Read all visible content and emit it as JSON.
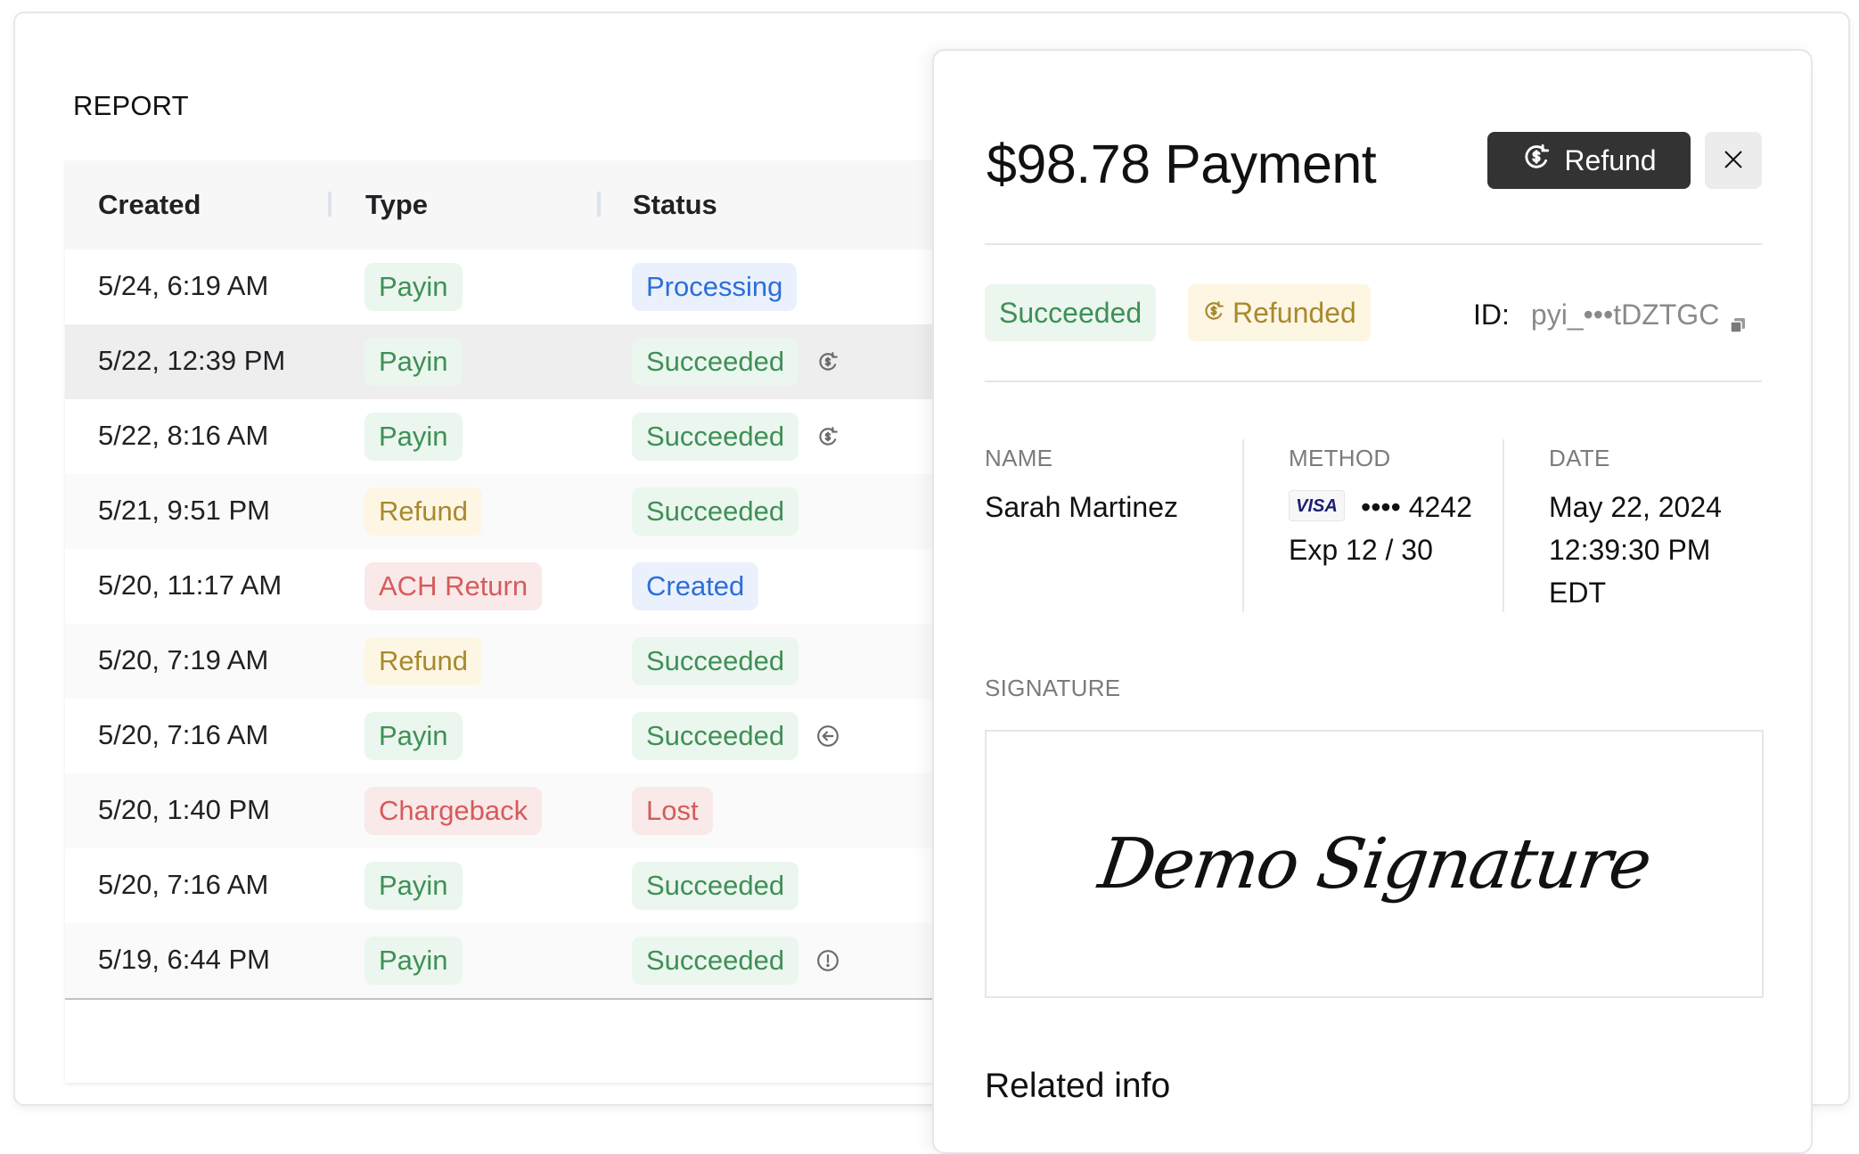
{
  "report": {
    "title": "REPORT",
    "columns": [
      "Created",
      "Type",
      "Status"
    ],
    "rows": [
      {
        "created": "5/24, 6:19 AM",
        "type": "Payin",
        "type_color": "green",
        "status": "Processing",
        "status_color": "blue",
        "icon": null,
        "selected": false
      },
      {
        "created": "5/22, 12:39 PM",
        "type": "Payin",
        "type_color": "green",
        "status": "Succeeded",
        "status_color": "green",
        "icon": "refund-icon",
        "selected": true
      },
      {
        "created": "5/22, 8:16 AM",
        "type": "Payin",
        "type_color": "green",
        "status": "Succeeded",
        "status_color": "green",
        "icon": "refund-icon",
        "selected": false
      },
      {
        "created": "5/21, 9:51 PM",
        "type": "Refund",
        "type_color": "yellow",
        "status": "Succeeded",
        "status_color": "green",
        "icon": null,
        "selected": false
      },
      {
        "created": "5/20, 11:17 AM",
        "type": "ACH Return",
        "type_color": "red",
        "status": "Created",
        "status_color": "blue",
        "icon": null,
        "selected": false
      },
      {
        "created": "5/20, 7:19 AM",
        "type": "Refund",
        "type_color": "yellow",
        "status": "Succeeded",
        "status_color": "green",
        "icon": null,
        "selected": false
      },
      {
        "created": "5/20, 7:16 AM",
        "type": "Payin",
        "type_color": "green",
        "status": "Succeeded",
        "status_color": "green",
        "icon": "return-arrow-icon",
        "selected": false
      },
      {
        "created": "5/20, 1:40 PM",
        "type": "Chargeback",
        "type_color": "red",
        "status": "Lost",
        "status_color": "red",
        "icon": null,
        "selected": false
      },
      {
        "created": "5/20, 7:16 AM",
        "type": "Payin",
        "type_color": "green",
        "status": "Succeeded",
        "status_color": "green",
        "icon": null,
        "selected": false
      },
      {
        "created": "5/19, 6:44 PM",
        "type": "Payin",
        "type_color": "green",
        "status": "Succeeded",
        "status_color": "green",
        "icon": "alert-icon",
        "selected": false
      }
    ]
  },
  "detail": {
    "title": "$98.78 Payment",
    "refund_button": "Refund",
    "badges": {
      "status": "Succeeded",
      "refunded": "Refunded"
    },
    "id_label": "ID:",
    "id_value": "pyi_•••tDZTGC",
    "name_label": "NAME",
    "name_value": "Sarah Martinez",
    "method_label": "METHOD",
    "card_brand": "VISA",
    "card_number": "•••• 4242",
    "card_exp": "Exp 12 / 30",
    "date_label": "DATE",
    "date_line1": "May 22, 2024",
    "date_line2": "12:39:30 PM",
    "date_line3": "EDT",
    "signature_label": "SIGNATURE",
    "signature_text": "Demo Signature",
    "related_heading": "Related info"
  },
  "colors": {
    "green": {
      "fg": "#3f8f56",
      "bg": "#eaf6ee"
    },
    "blue": {
      "fg": "#2c6ed6",
      "bg": "#eaf1fd"
    },
    "yellow": {
      "fg": "#a8892e",
      "bg": "#fdf6e3"
    },
    "red": {
      "fg": "#d65b5b",
      "bg": "#f9e9e9"
    },
    "primary_button": "#333333"
  }
}
